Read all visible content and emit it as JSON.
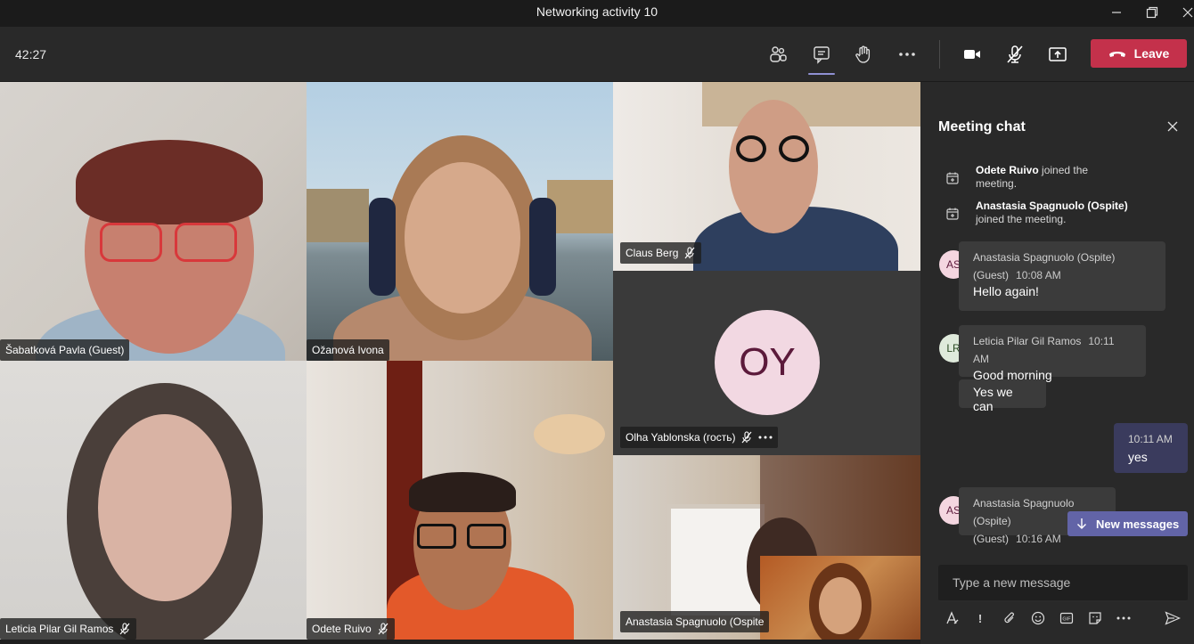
{
  "window": {
    "title": "Networking activity 10"
  },
  "toolbar": {
    "timer": "42:27",
    "leave_label": "Leave"
  },
  "participants": [
    {
      "name": "Šabatková Pavla (Guest)"
    },
    {
      "name": "Ožanová Ivona"
    },
    {
      "name": "Claus Berg"
    },
    {
      "name": "Olha Yablonska (гость)",
      "initials": "OY"
    },
    {
      "name": "Leticia Pilar Gil Ramos"
    },
    {
      "name": "Odete Ruivo"
    },
    {
      "name": "Anastasia Spagnuolo (Ospite"
    }
  ],
  "chat": {
    "title": "Meeting chat",
    "system": [
      {
        "bold": "Odete Ruivo",
        "line1": " joined the",
        "line2": "meeting."
      },
      {
        "bold": "Anastasia Spagnuolo (Ospite)",
        "line1": "",
        "line2": "joined the meeting."
      }
    ],
    "messages": [
      {
        "initials": "AS",
        "sender": "Anastasia Spagnuolo (Ospite)",
        "sender2": "(Guest)",
        "time": "10:08 AM",
        "text": "Hello again!"
      },
      {
        "initials": "LR",
        "sender": "Leticia Pilar Gil Ramos",
        "time": "10:11 AM",
        "text": "Good morning",
        "text2": "Yes we can"
      },
      {
        "initials": "AS",
        "sender": "Anastasia Spagnuolo (Ospite)",
        "sender2": "(Guest)",
        "time": "10:16 AM"
      }
    ],
    "mine": {
      "time": "10:11 AM",
      "text": "yes"
    },
    "new_messages_label": "New messages",
    "compose_placeholder": "Type a new message"
  },
  "colors": {
    "accent": "#6264a7",
    "leave": "#c4314b",
    "avatar_as": "#f4d6e0",
    "avatar_lr": "#dfeadb",
    "oy_circle": "#f2d8e2",
    "oy_text": "#5c1a3b"
  }
}
